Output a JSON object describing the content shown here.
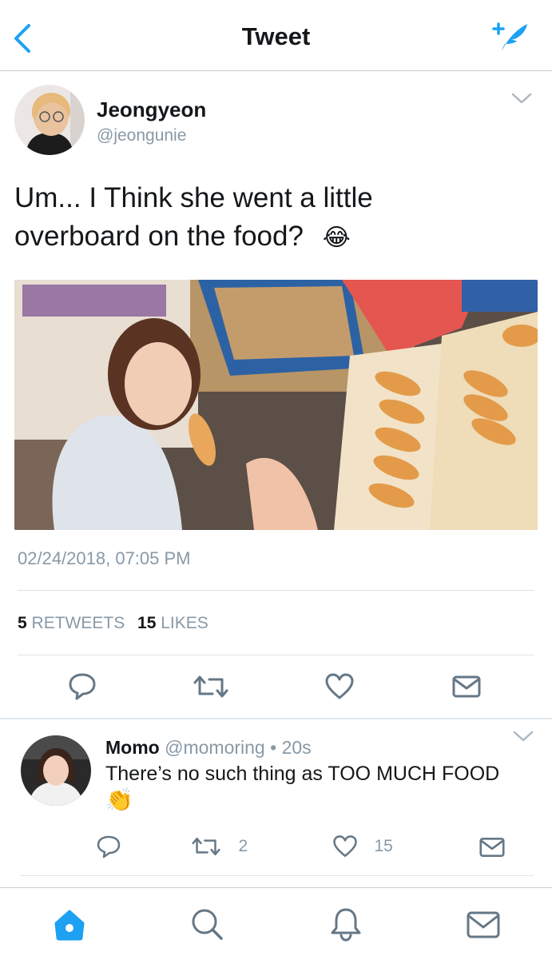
{
  "header": {
    "title": "Tweet",
    "back_icon": "chevron-left-icon",
    "compose_icon": "compose-tweet-icon",
    "accent": "#1da1f2"
  },
  "tweet": {
    "author_name": "Jeongyeon",
    "author_handle": "@jeongunie",
    "text": "Um... I Think she went a little overboard on the food?",
    "emoji": "😂",
    "timestamp": "02/24/2018, 07:05 PM",
    "retweets_count": "5",
    "retweets_label": "RETWEETS",
    "likes_count": "15",
    "likes_label": "LIKES"
  },
  "reply": {
    "author_name": "Momo",
    "author_handle": "@momoring",
    "separator": "•",
    "time": "20s",
    "text": "There’s no such thing as TOO MUCH FOOD",
    "emoji": "👏",
    "retweet_count": "2",
    "like_count": "15"
  },
  "tabbar": {
    "items": [
      "home-icon",
      "search-icon",
      "notifications-icon",
      "messages-icon"
    ]
  }
}
